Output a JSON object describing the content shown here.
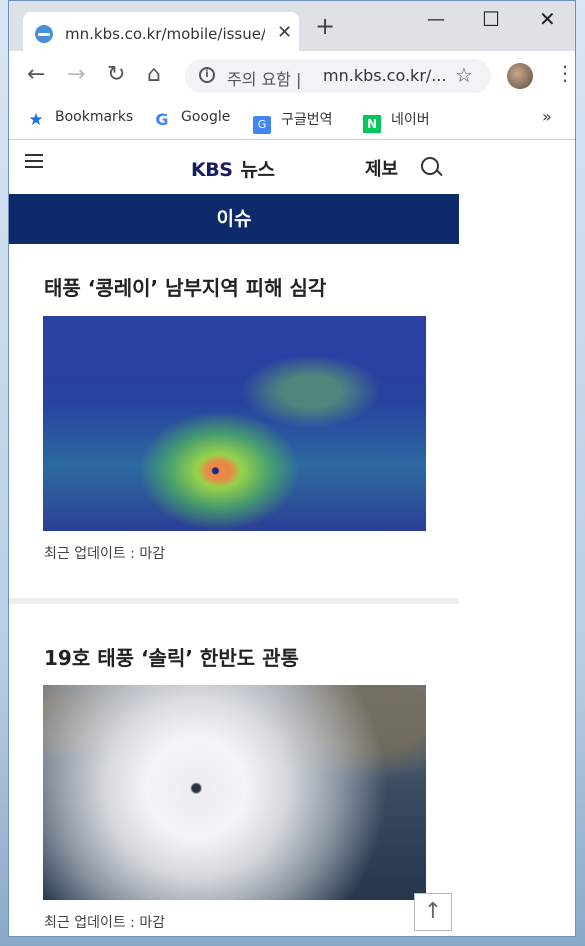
{
  "browser": {
    "tab_title": "mn.kbs.co.kr/mobile/issue/m",
    "omnibox_warning": "주의 요함 |",
    "omnibox_url": "mn.kbs.co.kr/...",
    "bookmarks": [
      {
        "label": "Bookmarks",
        "icon": "star-icon",
        "icon_color": "#1a73e8"
      },
      {
        "label": "Google",
        "icon": "google-icon",
        "icon_color": "#4285f4"
      },
      {
        "label": "구글번역",
        "icon": "translate-icon",
        "icon_color": "#4285f4"
      },
      {
        "label": "네이버",
        "icon": "naver-icon",
        "icon_color": "#03c75a"
      }
    ],
    "bookmarks_overflow": "»"
  },
  "header": {
    "logo_kbs": "KBS",
    "logo_news": "뉴스",
    "report_label": "제보"
  },
  "issue_bar": {
    "label": "이슈"
  },
  "articles": [
    {
      "title": "태풍 ‘콩레이’ 남부지역 피해 심각",
      "meta": "최근 업데이트 : 마감"
    },
    {
      "title": "19호 태풍 ‘솔릭’ 한반도 관통",
      "meta": "최근 업데이트 : 마감"
    }
  ],
  "colors": {
    "accent": "#0d2a6b",
    "logo": "#1a1a66"
  }
}
